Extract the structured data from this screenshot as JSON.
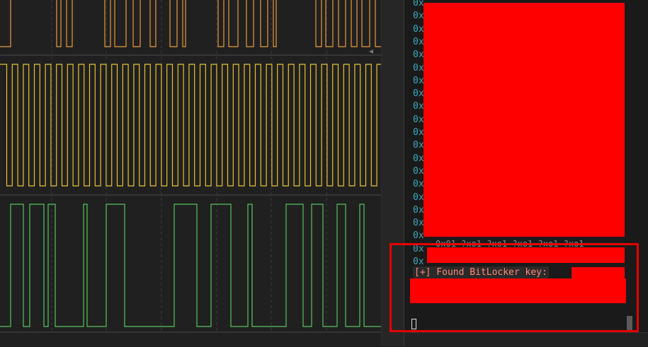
{
  "terminal": {
    "address_prefix": "0x",
    "found_message": "[+] Found BitLocker key:",
    "overlap_fragment": "0x01 ?xo1 ?xo1 ?xo1 ?xo1 ?xo1"
  },
  "colors": {
    "channel_orange": "#e89a3c",
    "channel_yellow": "#e8c230",
    "channel_green": "#56c45c",
    "highlight_box": "#e60000",
    "redaction": "#ff0000",
    "address_text": "#3fa8b8",
    "found_text": "#ff8a7a"
  },
  "icons": {
    "cursor": "block-cursor-icon",
    "marker": "arrow-marker-icon"
  }
}
